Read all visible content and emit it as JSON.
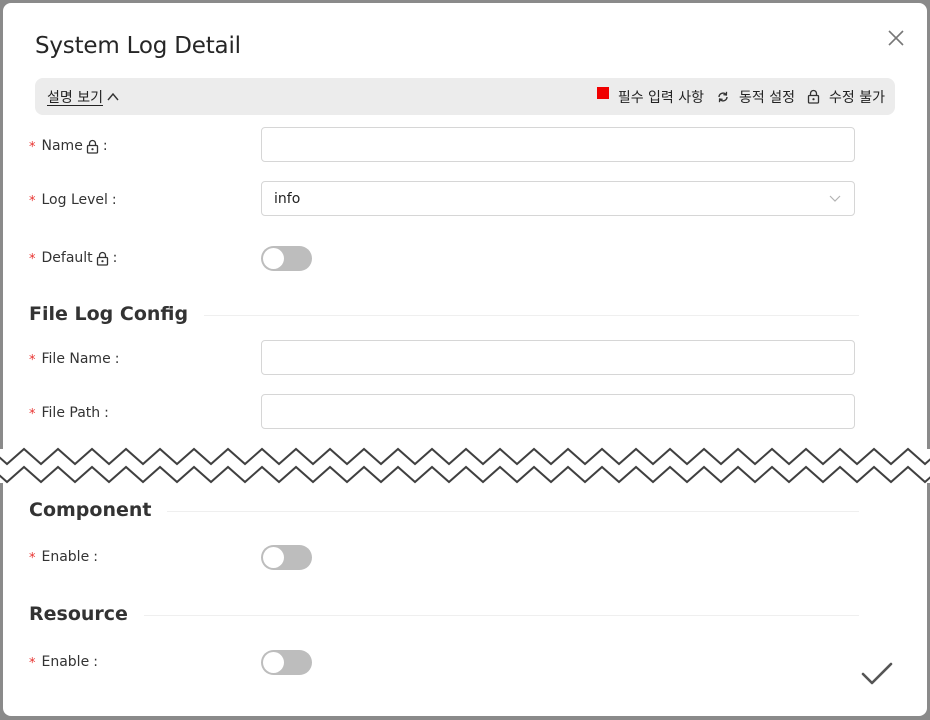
{
  "dialog": {
    "title": "System Log Detail"
  },
  "legend": {
    "toggle_label": "설명 보기",
    "toggle_chevron": "^",
    "required_label": "필수 입력 사항",
    "dynamic_label": "동적 설정",
    "readonly_label": "수정 불가",
    "required_color": "#f00000"
  },
  "fields": {
    "name": {
      "label": "Name",
      "value": ""
    },
    "log_level": {
      "label": "Log Level",
      "value": "info"
    },
    "default": {
      "label": "Default",
      "checked": false
    }
  },
  "file_log_config": {
    "title": "File Log Config",
    "file_name": {
      "label": "File Name",
      "value": ""
    },
    "file_path": {
      "label": "File Path",
      "value": ""
    }
  },
  "component": {
    "title": "Component",
    "enable": {
      "label": "Enable",
      "checked": false
    }
  },
  "resource": {
    "title": "Resource",
    "enable": {
      "label": "Enable",
      "checked": false
    }
  },
  "required_mark": "*",
  "colon": ":",
  "icons": {
    "close": "close-icon",
    "lock": "lock-icon",
    "refresh": "refresh-icon",
    "confirm": "checkmark-icon",
    "dropdown": "chevron-down-icon"
  },
  "colors": {
    "required_asterisk": "#e8322f",
    "toggle_off": "#bdbdbd",
    "legend_bg": "#ececec"
  }
}
